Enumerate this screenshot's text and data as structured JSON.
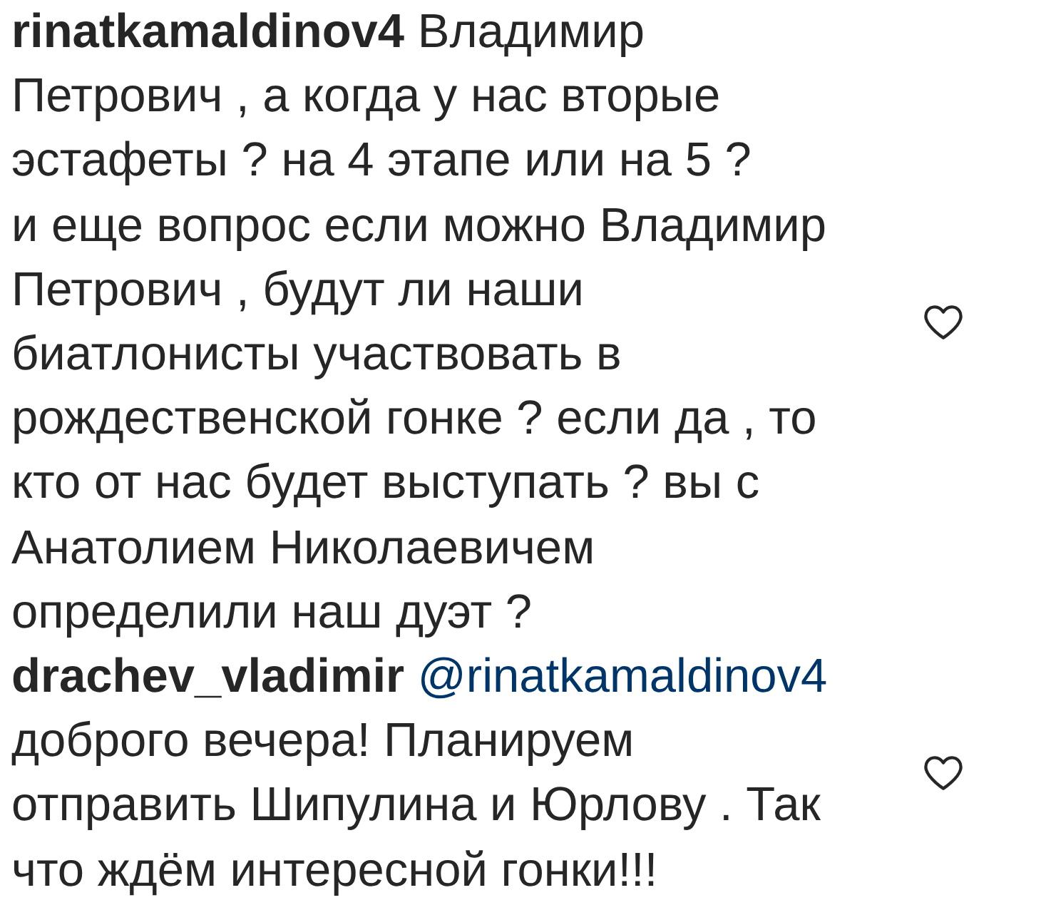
{
  "comments": [
    {
      "username": "rinatkamaldinov4",
      "text": "Владимир Петрович , а когда у нас вторые эстафеты ? на 4 этапе или на 5 ?\nи еще вопрос если можно Владимир Петрович , будут ли наши биатлонисты участвовать в рождественской гонке ? если да , то кто от нас будет выступать ? вы с Анатолием Николаевичем определили наш дуэт ?",
      "liked": false
    },
    {
      "username": "drachev_vladimir",
      "mention": "@rinatkamaldinov4",
      "text": "доброго вечера! Планируем отправить Шипулина и Юрлову . Так что ждём интересной гонки!!!",
      "liked": false
    }
  ]
}
